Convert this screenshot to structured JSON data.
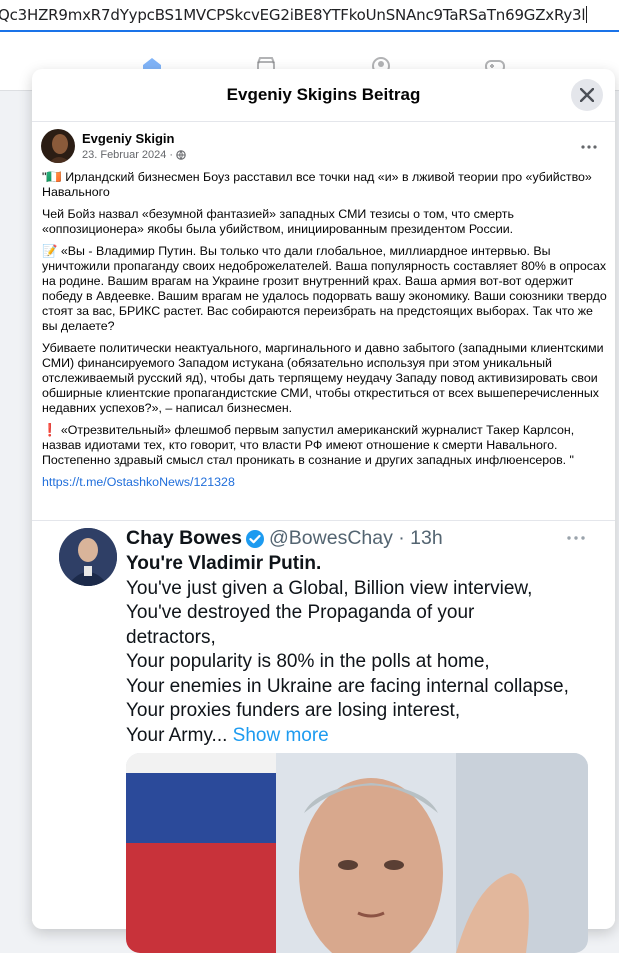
{
  "browser": {
    "url": "Qc3HZR9mxR7dYypcBS1MVCPSkcvEG2iBE8YTFkoUnSNAnc9TaRSaTn69GZxRy3l"
  },
  "nav_icons": [
    "home-icon",
    "marketplace-icon",
    "groups-icon",
    "gaming-icon"
  ],
  "modal": {
    "title": "Evgeniy Skigins Beitrag",
    "close_icon": "close-icon"
  },
  "post": {
    "author": "Evgeniy Skigin",
    "date": "23. Februar 2024",
    "separator": "·",
    "audience_icon": "globe-icon",
    "paragraphs": [
      "\"🇮🇪 Ирландский бизнесмен Боуз расставил все точки над «и» в лживой теории про «убийство» Навального",
      "Чей Бойз назвал «безумной фантазией» западных СМИ тезисы о том, что смерть «оппозиционера» якобы была убийством, инициированным президентом России.",
      "📝 «Вы - Владимир Путин. Вы только что дали глобальное, миллиардное интервью. Вы уничтожили пропаганду своих недоброжелателей. Ваша популярность составляет 80% в опросах на родине. Вашим врагам на Украине грозит внутренний крах. Ваша армия вот-вот одержит победу в Авдеевке. Вашим врагам не удалось подорвать вашу экономику. Ваши союзники твердо стоят за вас, БРИКС растет. Вас собираются переизбрать на предстоящих выборах. Так что же вы делаете?",
      "Убиваете политически неактуального, маргинального и давно забытого (западными клиентскими СМИ) финансируемого Западом истукана (обязательно используя при этом уникальный отслеживаемый русский яд), чтобы дать терпящему неудачу Западу повод активизировать свои обширные клиентские пропагандистские СМИ, чтобы открестить­ся от всех вышеперечисленных недавних успехов?», – написал бизнесмен.",
      "❗ «Отрезвительный» флешмоб первым запустил американский журналист Такер Карлсон, назвав идиотами тех, кто говорит, что власти РФ имеют отношение к смерти Навального. Постепенно здравый смысл стал проникать в сознание и других западных инфлюенсеров. \""
    ],
    "link": "https://t.me/OstashkoNews/121328"
  },
  "tweet": {
    "name": "Chay Bowes",
    "handle": "@BowesChay · 13h",
    "lines": [
      "You're Vladimir Putin.",
      "You've just given a Global, Billion view interview,",
      "You've destroyed the Propaganda of your",
      "detractors,",
      "Your popularity is 80% in the polls at home,",
      "Your enemies in Ukraine are facing internal collapse,",
      "Your proxies funders are losing interest,",
      "Your Army... "
    ],
    "show_more": "Show more",
    "verified_color": "#1d9bf0"
  }
}
